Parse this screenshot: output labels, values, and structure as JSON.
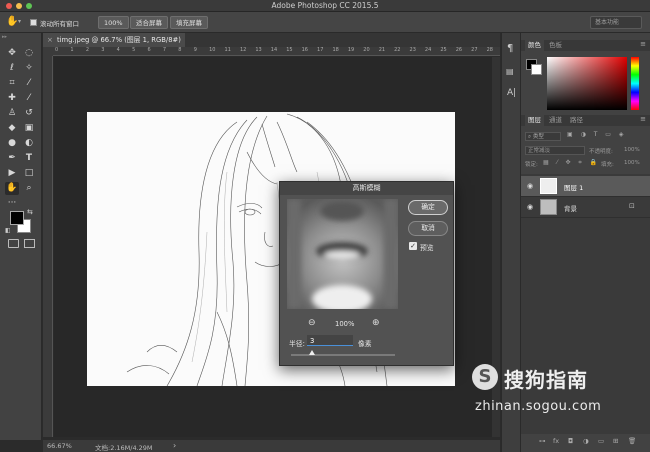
{
  "window": {
    "title": "Adobe Photoshop CC 2015.5"
  },
  "options_bar": {
    "scroll_all_windows": "滚动所有窗口",
    "zoom_value": "100%",
    "fit_screen": "适合屏幕",
    "fill_screen": "填充屏幕",
    "workspace": "基本功能"
  },
  "document_tab": {
    "label": "timg.jpeg @ 66.7% (图层 1, RGB/8#) *"
  },
  "rulers": {
    "top_ticks": [
      "0",
      "1",
      "2",
      "3",
      "4",
      "5",
      "6",
      "7",
      "8",
      "9",
      "10",
      "11",
      "12",
      "13",
      "14",
      "15",
      "16",
      "17",
      "18",
      "19",
      "20",
      "21",
      "22",
      "23",
      "24",
      "25",
      "26",
      "27",
      "28"
    ]
  },
  "status_bar": {
    "zoom": "66.67%",
    "doc_info": "文档:2.16M/4.29M",
    "arrow": "›"
  },
  "color_panel": {
    "tabs": [
      "颜色",
      "色板"
    ],
    "active_tab": 0
  },
  "layers_panel": {
    "tabs": [
      "图层",
      "通道",
      "路径"
    ],
    "active_tab": 0,
    "kind_filter": "类型",
    "blend_mode": "正常减淡",
    "opacity_label": "不透明度:",
    "opacity_value": "100%",
    "lock_label": "锁定:",
    "fill_label": "填充:",
    "fill_value": "100%",
    "layers": [
      {
        "name": "图层 1",
        "visible": true,
        "selected": true
      },
      {
        "name": "背景",
        "visible": true,
        "selected": false,
        "locked": true
      }
    ]
  },
  "dialog": {
    "title": "高斯模糊",
    "ok": "确定",
    "cancel": "取消",
    "preview_label": "预览",
    "preview_checked": true,
    "zoom_value": "100%",
    "radius_label": "半径:",
    "radius_value": "3",
    "radius_unit": "像素",
    "radius_slider_fraction": 0.2
  },
  "watermark": {
    "brand": "搜狗指南",
    "url": "zhinan.sogou.com"
  },
  "colors": {
    "accent_blue": "#4a90d9",
    "foreground": "#000000",
    "background": "#ffffff",
    "picker_hue": "#e00000"
  },
  "icons": {
    "tools": [
      "move-icon",
      "marquee-icon",
      "lasso-icon",
      "magic-wand-icon",
      "crop-icon",
      "eyedropper-icon",
      "healing-brush-icon",
      "brush-icon",
      "stamp-icon",
      "history-brush-icon",
      "eraser-icon",
      "gradient-icon",
      "blur-icon",
      "dodge-icon",
      "pen-icon",
      "type-icon",
      "path-select-icon",
      "rectangle-icon",
      "hand-icon",
      "zoom-icon",
      "more-tools-icon"
    ]
  }
}
